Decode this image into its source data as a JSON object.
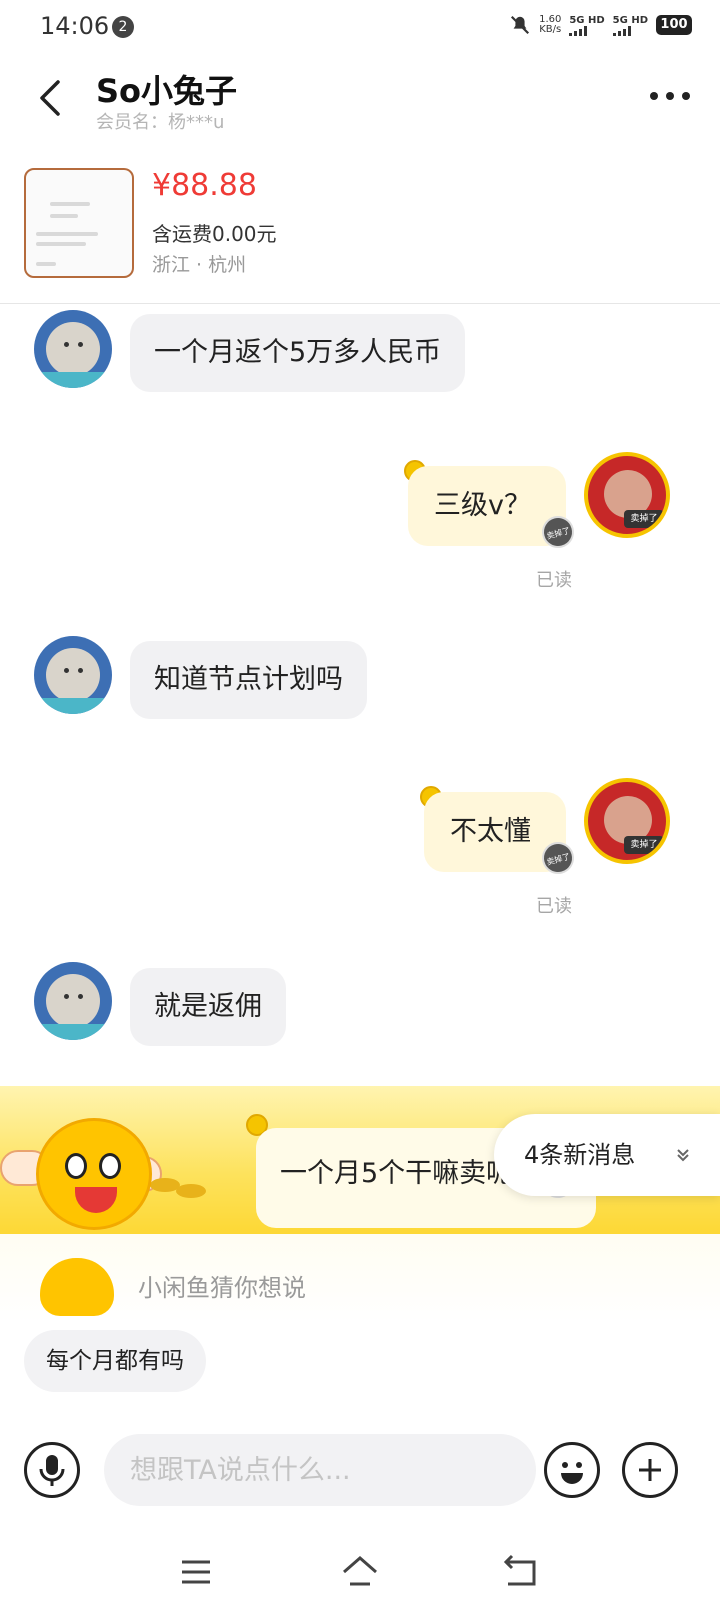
{
  "status_bar": {
    "time": "14:06",
    "notification_count": "2",
    "net_speed_value": "1.60",
    "net_speed_unit": "KB/s",
    "sim1": "5G HD",
    "sim2": "5G HD",
    "battery": "100"
  },
  "header": {
    "title": "So小兔子",
    "subtitle": "会员名：杨***u"
  },
  "product": {
    "price": "¥88.88",
    "shipping": "含运费0.00元",
    "location": "浙江 · 杭州"
  },
  "messages": [
    {
      "side": "left",
      "text": "一个月返个5万多人民币"
    },
    {
      "side": "right",
      "text": "三级v？",
      "status": "已读"
    },
    {
      "side": "left",
      "text": "知道节点计划吗"
    },
    {
      "side": "right",
      "text": "不太懂",
      "status": "已读"
    },
    {
      "side": "left",
      "text": "就是返佣"
    },
    {
      "side": "right",
      "text": "一个月5个干嘛卖呢"
    }
  ],
  "sold_stamp_label": "卖掉了",
  "new_messages_label": "4条新消息",
  "suggestions": {
    "title": "小闲鱼猜你想说",
    "chips": [
      "每个月都有吗"
    ]
  },
  "input": {
    "placeholder": "想跟TA说点什么..."
  },
  "colors": {
    "price": "#ef3b36",
    "bubble_left": "#f1f1f3",
    "bubble_right": "#fff7da",
    "banner": "#fde25c"
  },
  "icons": [
    "back-arrow-icon",
    "more-icon",
    "mute-icon",
    "coin-icon",
    "chevron-down-icon",
    "microphone-icon",
    "emoji-icon",
    "plus-icon",
    "menu-icon",
    "home-icon",
    "back-nav-icon"
  ]
}
